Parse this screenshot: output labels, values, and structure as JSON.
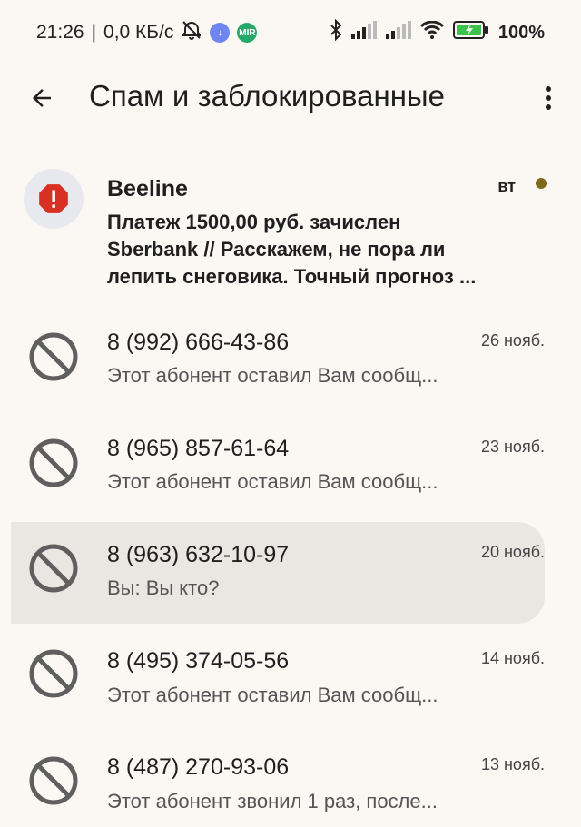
{
  "status_bar": {
    "time": "21:26",
    "separator": "|",
    "network_speed": "0,0 КБ/с",
    "battery": "100%",
    "colors": {
      "download_badge": "#6f86f0",
      "mir_badge": "#27a86b",
      "battery_fill": "#3cc14a"
    }
  },
  "app_bar": {
    "title": "Спам и заблокированные"
  },
  "conversations": [
    {
      "name": "Beeline",
      "date": "вт",
      "snippet": "Платеж  1500,00 руб. зачислен Sberbank // Расскажем, не пора ли лепить снеговика. Точный прогноз ...",
      "icon": "spam-warning-icon",
      "unread": true
    },
    {
      "name": "8 (992) 666-43-86",
      "date": "26 нояб.",
      "snippet": "Этот абонент оставил Вам сообщ...",
      "icon": "blocked-icon"
    },
    {
      "name": "8 (965) 857-61-64",
      "date": "23 нояб.",
      "snippet": "Этот абонент оставил Вам сообщ...",
      "icon": "blocked-icon"
    },
    {
      "name": "8 (963) 632-10-97",
      "date": "20 нояб.",
      "snippet": "Вы: Вы кто?",
      "icon": "blocked-icon",
      "selected": true
    },
    {
      "name": "8 (495) 374-05-56",
      "date": "14 нояб.",
      "snippet": "Этот абонент оставил Вам сообщ...",
      "icon": "blocked-icon"
    },
    {
      "name": "8 (487) 270-93-06",
      "date": "13 нояб.",
      "snippet": "Этот абонент звонил 1 раз, после...",
      "icon": "blocked-icon"
    }
  ]
}
